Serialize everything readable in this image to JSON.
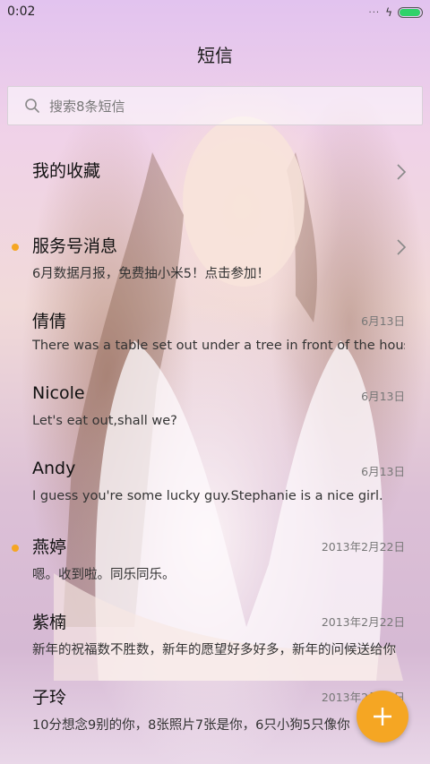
{
  "status_bar": {
    "time": "0:02",
    "signal_glyph": "···",
    "charging_glyph": "ϟ",
    "battery_color": "#2fd26a"
  },
  "header": {
    "title": "短信"
  },
  "search": {
    "placeholder": "搜索8条短信",
    "value": ""
  },
  "list": {
    "favorites": {
      "title": "我的收藏"
    },
    "service": {
      "title": "服务号消息",
      "preview": "6月数据月报，免费抽小米5！点击参加！",
      "unread": true
    },
    "conversations": [
      {
        "name": "倩倩",
        "preview": "There was a table set out under a tree in front of the house",
        "date": "6月13日",
        "unread": false
      },
      {
        "name": "Nicole",
        "preview": "Let's eat out,shall we?",
        "date": "6月13日",
        "unread": false
      },
      {
        "name": "Andy",
        "preview": "I guess you're some lucky guy.Stephanie is a nice girl.",
        "date": "6月13日",
        "unread": false
      },
      {
        "name": "燕婷",
        "preview": "嗯。收到啦。同乐同乐。",
        "date": "2013年2月22日",
        "unread": true
      },
      {
        "name": "紫楠",
        "preview": "新年的祝福数不胜数，新年的愿望好多好多，新年的问候送给你",
        "date": "2013年2月22日",
        "unread": false
      },
      {
        "name": "子玲",
        "preview": "10分想念9别的你，8张照片7张是你，6只小狗5只像你",
        "date": "2013年2月22日",
        "unread": false
      }
    ]
  },
  "fab": {
    "icon": "plus-icon",
    "color": "#f5a623"
  },
  "colors": {
    "accent": "#f5a623",
    "unread_dot": "#f5a623"
  }
}
